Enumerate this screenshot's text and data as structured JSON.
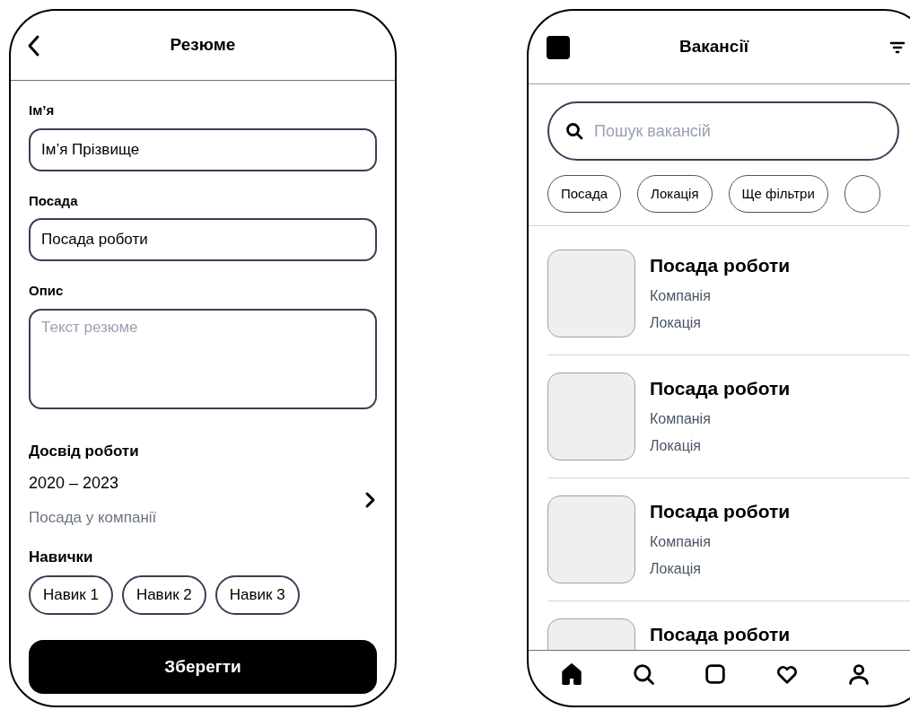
{
  "resume": {
    "title": "Резюме",
    "fields": [
      {
        "label": "Ім’я",
        "value": "Ім’я Прізвище",
        "kind": "input"
      },
      {
        "label": "Посада",
        "value": "Посада роботи",
        "kind": "input"
      },
      {
        "label": "Опис",
        "placeholder": "Текст резюме",
        "kind": "textarea"
      }
    ],
    "experience": {
      "heading": "Досвід роботи",
      "period": "2020 – 2023",
      "position": "Посада у компанії"
    },
    "skills": {
      "heading": "Навички",
      "items": [
        "Навик 1",
        "Навик 2",
        "Навик 3"
      ]
    },
    "save_button": "Зберегти"
  },
  "vacancies": {
    "title": "Вакансії",
    "search": {
      "placeholder": "Пошук вакансій"
    },
    "filters": [
      "Посада",
      "Локація",
      "Ще фільтри"
    ],
    "jobs": [
      {
        "title": "Посада роботи",
        "company": "Компанія",
        "location": "Локація"
      },
      {
        "title": "Посада роботи",
        "company": "Компанія",
        "location": "Локація"
      },
      {
        "title": "Посада роботи",
        "company": "Компанія",
        "location": "Локація"
      },
      {
        "title": "Посада роботи"
      }
    ],
    "nav": [
      {
        "kind": "home",
        "selected": true
      },
      {
        "kind": "search",
        "selected": false
      },
      {
        "kind": "square",
        "selected": false
      },
      {
        "kind": "heart",
        "selected": false
      },
      {
        "kind": "profile",
        "selected": false
      }
    ]
  }
}
